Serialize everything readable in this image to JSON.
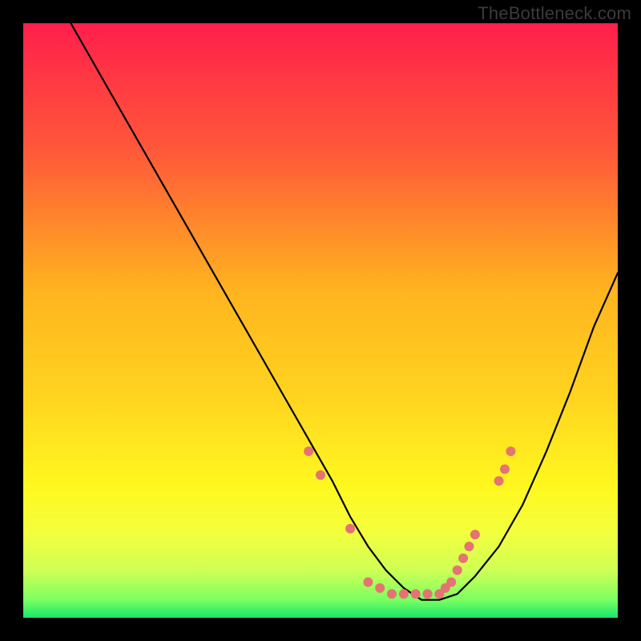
{
  "attribution": "TheBottleneck.com",
  "gradient_colors": {
    "top": "#ff1f4b",
    "mid_upper": "#ff8a2a",
    "mid": "#ffd21f",
    "mid_lower": "#f6ff3a",
    "band": "#d8ff58",
    "bottom": "#17e66b"
  },
  "chart_data": {
    "type": "line",
    "title": "",
    "xlabel": "",
    "ylabel": "",
    "xlim": [
      0,
      100
    ],
    "ylim": [
      0,
      100
    ],
    "series": [
      {
        "name": "bottleneck-curve",
        "x": [
          8,
          12,
          16,
          20,
          24,
          28,
          32,
          36,
          40,
          44,
          48,
          52,
          55,
          58,
          61,
          64,
          67,
          70,
          73,
          76,
          80,
          84,
          88,
          92,
          96,
          100
        ],
        "y": [
          100,
          93,
          86,
          79,
          72,
          65,
          58,
          51,
          44,
          37,
          30,
          23,
          17,
          12,
          8,
          5,
          3,
          3,
          4,
          7,
          12,
          19,
          28,
          38,
          49,
          58
        ]
      }
    ],
    "markers": {
      "name": "dot-markers",
      "color": "#e57373",
      "radius_px": 6,
      "points_xy": [
        [
          48,
          28
        ],
        [
          50,
          24
        ],
        [
          55,
          15
        ],
        [
          58,
          6
        ],
        [
          60,
          5
        ],
        [
          62,
          4
        ],
        [
          64,
          4
        ],
        [
          66,
          4
        ],
        [
          68,
          4
        ],
        [
          70,
          4
        ],
        [
          71,
          5
        ],
        [
          72,
          6
        ],
        [
          73,
          8
        ],
        [
          74,
          10
        ],
        [
          75,
          12
        ],
        [
          76,
          14
        ],
        [
          80,
          23
        ],
        [
          81,
          25
        ],
        [
          82,
          28
        ]
      ]
    }
  }
}
